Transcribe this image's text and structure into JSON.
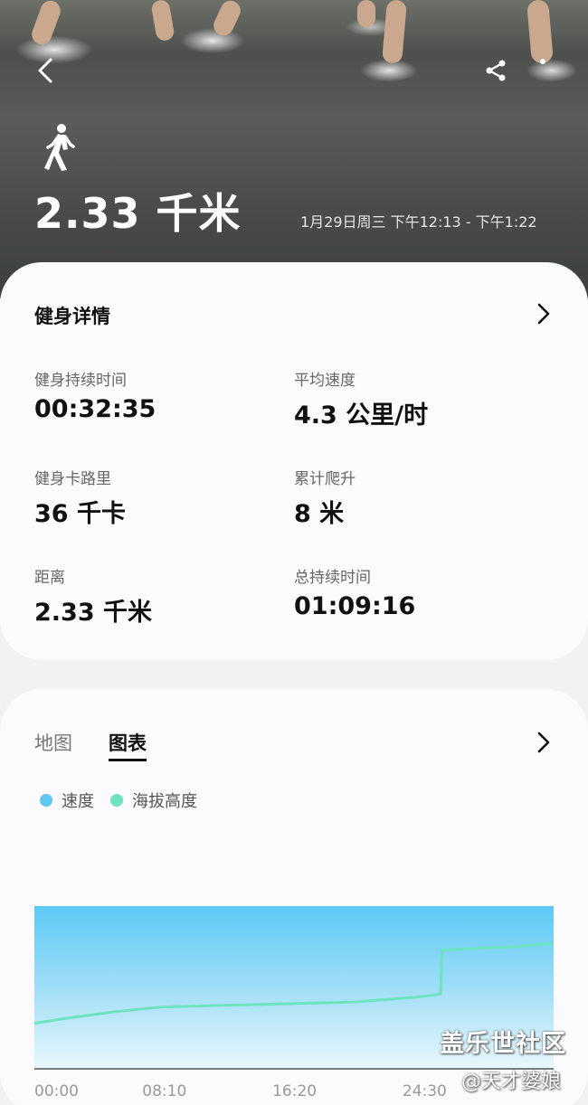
{
  "hero": {
    "distance": "2.33 千米",
    "date_range": "1月29日周三 下午12:13 - 下午1:22",
    "back_icon": "chevron-left-icon",
    "share_icon": "share-icon",
    "activity_icon": "walking-icon"
  },
  "details": {
    "title": "健身详情",
    "stats": [
      {
        "label": "健身持续时间",
        "value": "00:32:35"
      },
      {
        "label": "平均速度",
        "value": "4.3 公里/时"
      },
      {
        "label": "健身卡路里",
        "value": "36 千卡"
      },
      {
        "label": "累计爬升",
        "value": "8 米"
      },
      {
        "label": "距离",
        "value": "2.33 千米"
      },
      {
        "label": "总持续时间",
        "value": "01:09:16"
      }
    ]
  },
  "chart_section": {
    "tabs": [
      {
        "label": "地图",
        "selected": false
      },
      {
        "label": "图表",
        "selected": true
      }
    ]
  },
  "chart_data": {
    "type": "area",
    "series": [
      {
        "name": "速度",
        "color": "#5ec8f2"
      },
      {
        "name": "海拔高度",
        "color": "#6ee3c0"
      }
    ],
    "x_ticks": [
      "00:00",
      "08:10",
      "16:20",
      "24:30"
    ],
    "altitude_line": {
      "x": [
        0,
        2,
        5,
        8,
        12,
        16,
        20,
        24,
        25.5,
        25.6,
        30,
        32.6
      ],
      "y": [
        0.28,
        0.31,
        0.35,
        0.38,
        0.39,
        0.4,
        0.41,
        0.44,
        0.46,
        0.73,
        0.75,
        0.77
      ]
    },
    "xlim": [
      0,
      32.6
    ],
    "ylim": [
      0,
      1
    ]
  },
  "watermark": {
    "brand": "盖乐世社区",
    "author": "@天才婆娘"
  }
}
